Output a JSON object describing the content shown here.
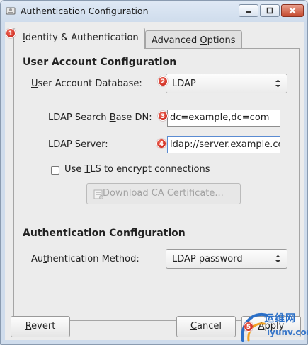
{
  "window": {
    "title": "Authentication Configuration",
    "controls": {
      "minimize": "—",
      "maximize": "□",
      "close": "✕"
    }
  },
  "tabs": [
    {
      "label_mnemonic": "I",
      "label_rest": "dentity & Authentication",
      "active": true
    },
    {
      "label_before": "Advanced ",
      "label_mnemonic": "O",
      "label_after": "ptions",
      "active": false
    }
  ],
  "user_account": {
    "heading": "User Account Configuration",
    "database_label_mnemonic": "U",
    "database_label_rest": "ser Account Database:",
    "database_value": "LDAP",
    "search_base_label_before": "LDAP Search ",
    "search_base_label_mnemonic": "B",
    "search_base_label_after": "ase DN:",
    "search_base_value": "dc=example,dc=com",
    "server_label_before": "LDAP ",
    "server_label_mnemonic": "S",
    "server_label_after": "erver:",
    "server_value": "ldap://server.example.com",
    "tls_label_before": "Use ",
    "tls_label_mnemonic": "T",
    "tls_label_after": "LS to encrypt connections",
    "tls_checked": false,
    "download_button_mnemonic": "D",
    "download_button_rest": "ownload CA Certificate..."
  },
  "auth_config": {
    "heading": "Authentication Configuration",
    "method_label_before": "Au",
    "method_label_mnemonic": "t",
    "method_label_after": "hentication Method:",
    "method_value": "LDAP password"
  },
  "buttons": {
    "revert_mnemonic": "R",
    "revert_rest": "evert",
    "cancel_mnemonic": "C",
    "cancel_rest": "ancel",
    "apply_mnemonic": "A",
    "apply_rest": "pply"
  },
  "annotations": [
    "1",
    "2",
    "3",
    "4",
    "5"
  ],
  "watermark": {
    "cn": "运维网",
    "en": "iyunv.com"
  },
  "colors": {
    "badge": "#d3251a",
    "watermark": "#2a6fc8"
  }
}
